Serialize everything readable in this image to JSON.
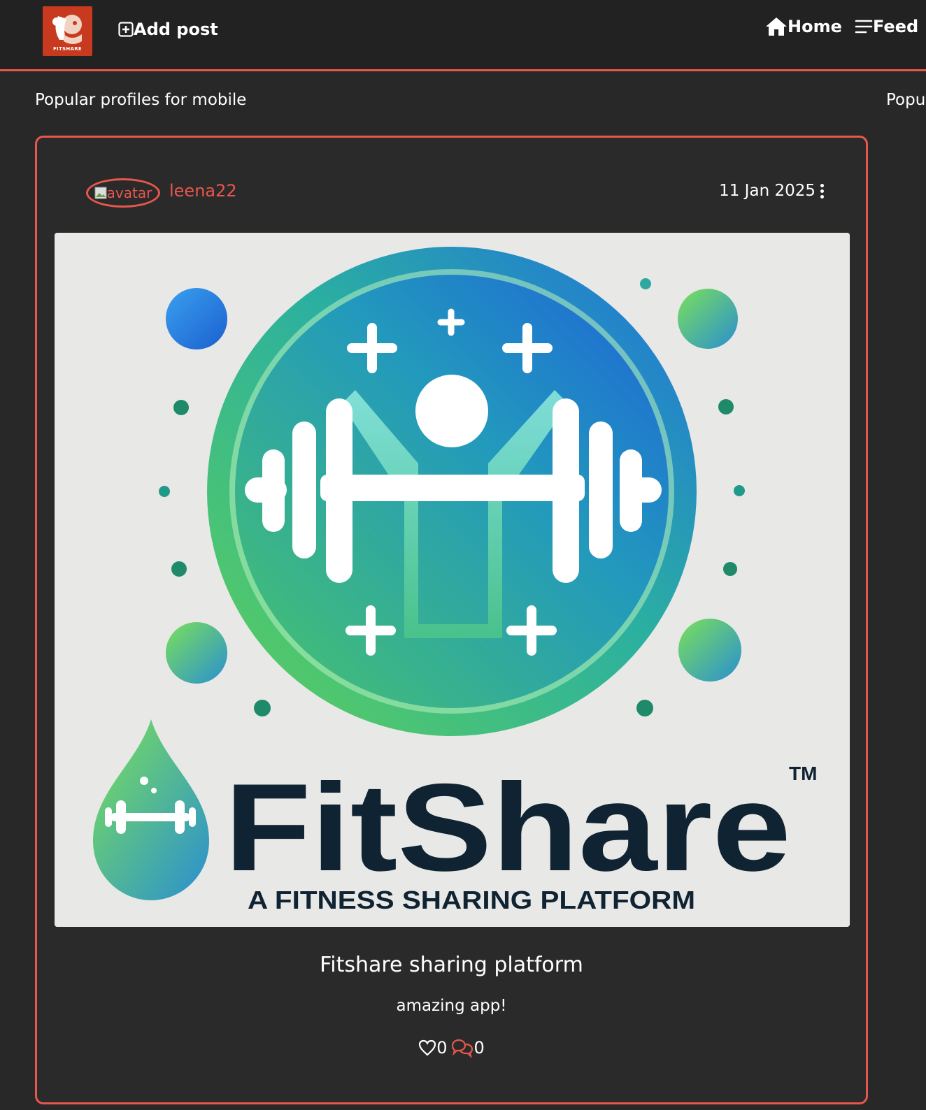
{
  "navbar": {
    "logo_text": "FITSHARE",
    "add_post_label": "Add post",
    "home_label": "Home",
    "feed_label": "Feed",
    "accent_color": "#e8574c"
  },
  "main": {
    "section_title": "Popular profiles for mobile",
    "section_title_2": "Popu"
  },
  "post": {
    "avatar_alt": "avatar",
    "username": "leena22",
    "date": "11 Jan 2025",
    "image": {
      "brand_name": "FitShare",
      "trademark": "TM",
      "tagline": "A FITNESS SHARING PLATFORM"
    },
    "title": "Fitshare sharing platform",
    "text": "amazing app!",
    "likes": "0",
    "comments": "0"
  }
}
